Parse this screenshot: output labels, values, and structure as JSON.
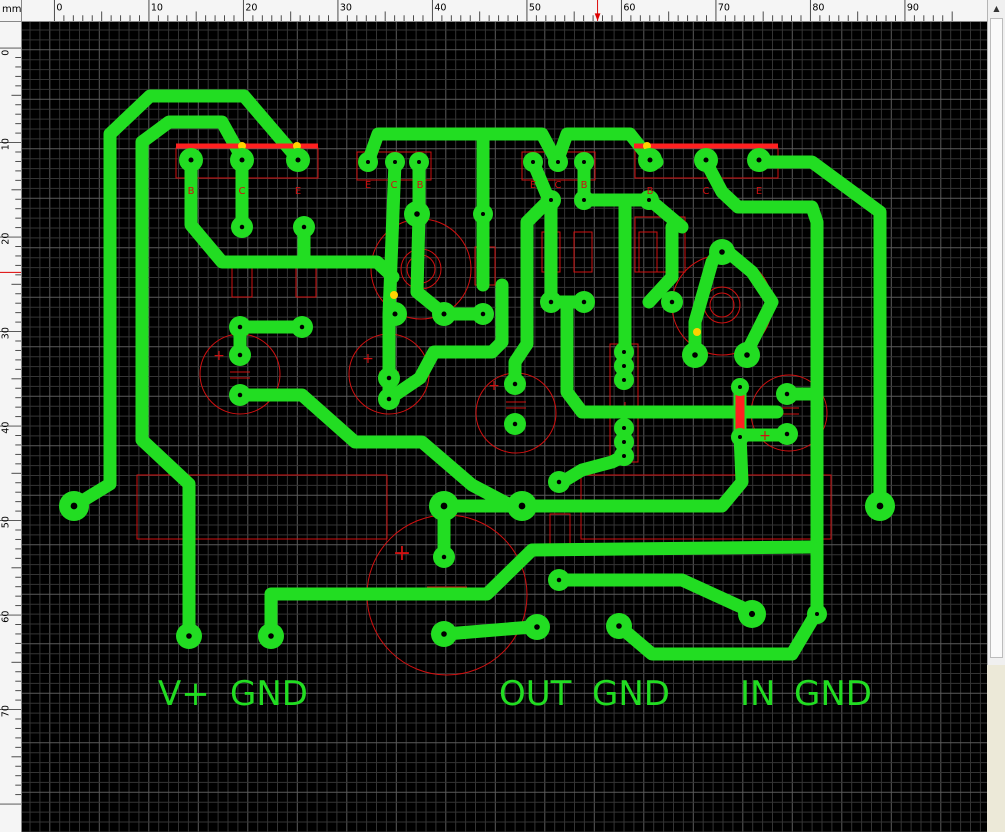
{
  "ruler": {
    "unit": "mm",
    "x_ticks": [
      "0",
      "10",
      "20",
      "30",
      "40",
      "50",
      "60",
      "70",
      "80",
      "90"
    ],
    "y_ticks": [
      "0",
      "10",
      "20",
      "30",
      "40",
      "50",
      "60",
      "70"
    ]
  },
  "components": {
    "t1_pins": [
      "B",
      "C",
      "E"
    ],
    "t2_pins": [
      "E",
      "C",
      "B"
    ],
    "t3_pins": [
      "E",
      "C",
      "B"
    ],
    "t4_pins": [
      "B",
      "C",
      "E"
    ],
    "polarity": "+"
  },
  "silkscreen": {
    "vplus": "V+",
    "gnd_power": "GND",
    "out": "OUT",
    "gnd_out": "GND",
    "in": "IN",
    "gnd_in": "GND"
  },
  "colors": {
    "board": "#000000",
    "grid": "#3c3c3c",
    "trace": "#22dd22",
    "trace_highlight": "#ff2020",
    "silk": "#d01010",
    "pad_hole": "#000000",
    "text": "#22dd22",
    "yellow": "#ffd200"
  },
  "scrollbar": {
    "up_icon": "triangle-up"
  }
}
